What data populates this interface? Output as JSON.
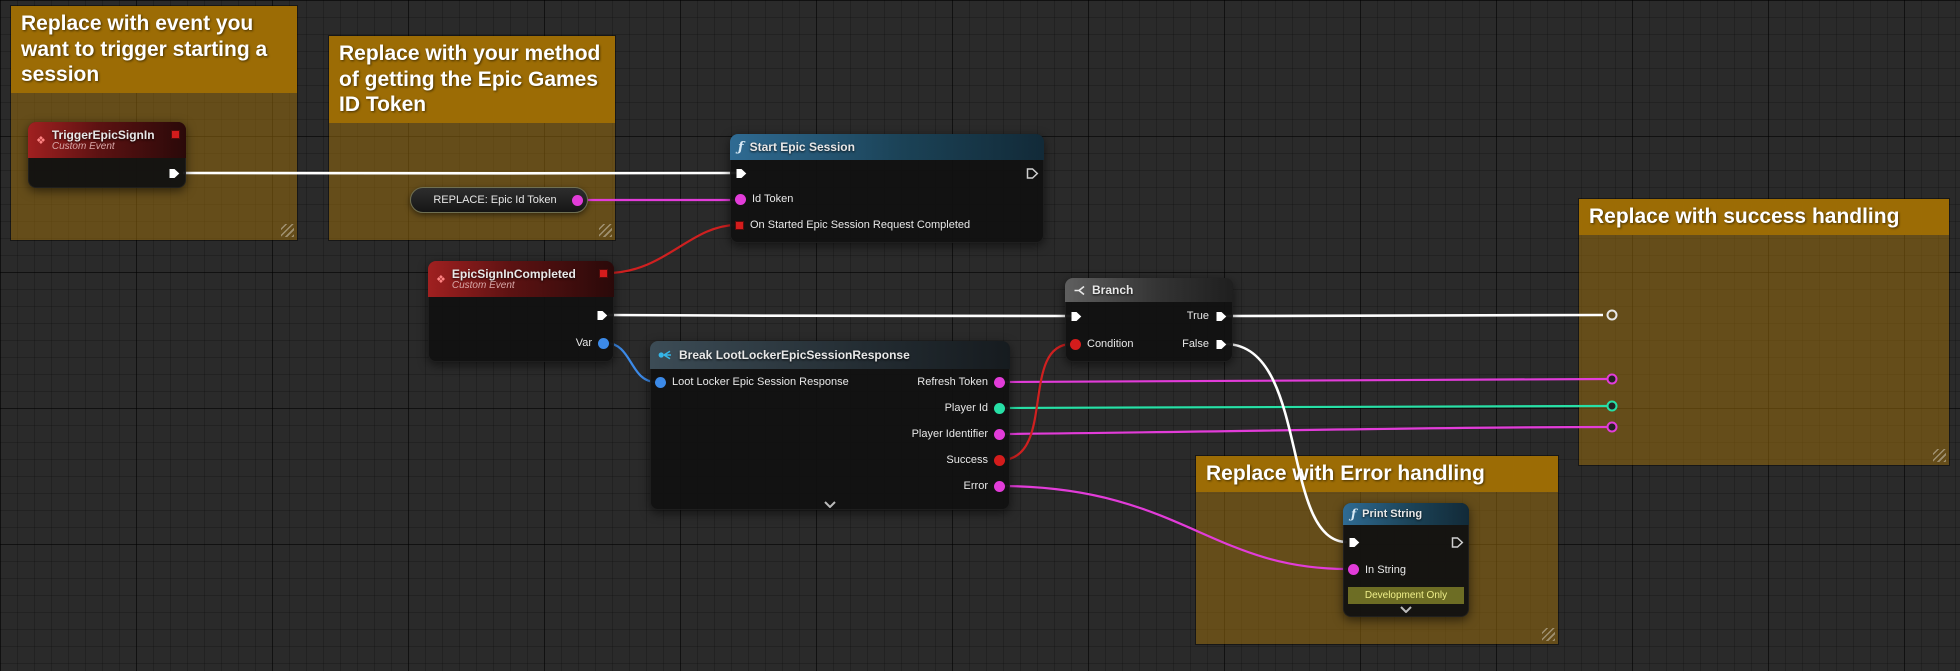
{
  "colors": {
    "background": "#2a2a2a",
    "comment": "#9c6c05",
    "exec_wire": "#ffffff",
    "string_pin": "#e23cd9",
    "bool_pin": "#d41c1c",
    "struct_pin": "#3c8ae8",
    "teal_pin": "#27e0a6",
    "delegate_pin": "#d41c1c"
  },
  "icons": {
    "function": "ƒ",
    "custom_event": "❖"
  },
  "comments": {
    "trigger": {
      "title": "Replace with event you want to trigger starting a session"
    },
    "token": {
      "title": "Replace with your method of getting the Epic Games ID Token"
    },
    "success": {
      "title": "Replace with success handling"
    },
    "error": {
      "title": "Replace with Error handling"
    }
  },
  "nodes": {
    "trigger_event": {
      "title": "TriggerEpicSignIn",
      "subtitle": "Custom Event"
    },
    "epic_id_token": {
      "label": "REPLACE: Epic Id Token"
    },
    "start_session": {
      "title": "Start Epic Session",
      "pins": {
        "id_token": "Id Token",
        "on_started": "On Started Epic Session Request Completed"
      }
    },
    "sign_in_completed": {
      "title": "EpicSignInCompleted",
      "subtitle": "Custom Event",
      "pins": {
        "var": "Var"
      }
    },
    "break_response": {
      "title": "Break LootLockerEpicSessionResponse",
      "pins": {
        "input": "Loot Locker Epic Session Response",
        "refresh_token": "Refresh Token",
        "player_id": "Player Id",
        "player_identifier": "Player Identifier",
        "success": "Success",
        "error": "Error"
      }
    },
    "branch": {
      "title": "Branch",
      "pins": {
        "condition": "Condition",
        "true_out": "True",
        "false_out": "False"
      }
    },
    "print_string": {
      "title": "Print String",
      "pins": {
        "in_string": "In String"
      },
      "dev_only": "Development Only"
    }
  }
}
